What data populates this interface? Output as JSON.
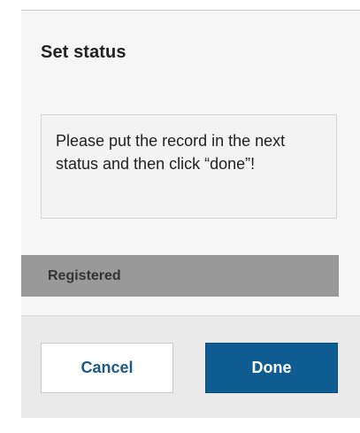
{
  "dialog": {
    "title": "Set status",
    "message": "Please put the record in the next status and then click “done”!",
    "status": "Registered",
    "buttons": {
      "cancel_label": "Cancel",
      "done_label": "Done"
    }
  },
  "colors": {
    "primary": "#0f5c92",
    "status_bar": "#999999",
    "dialog_background": "#f6f6f6",
    "footer_background": "#eaeaea"
  }
}
